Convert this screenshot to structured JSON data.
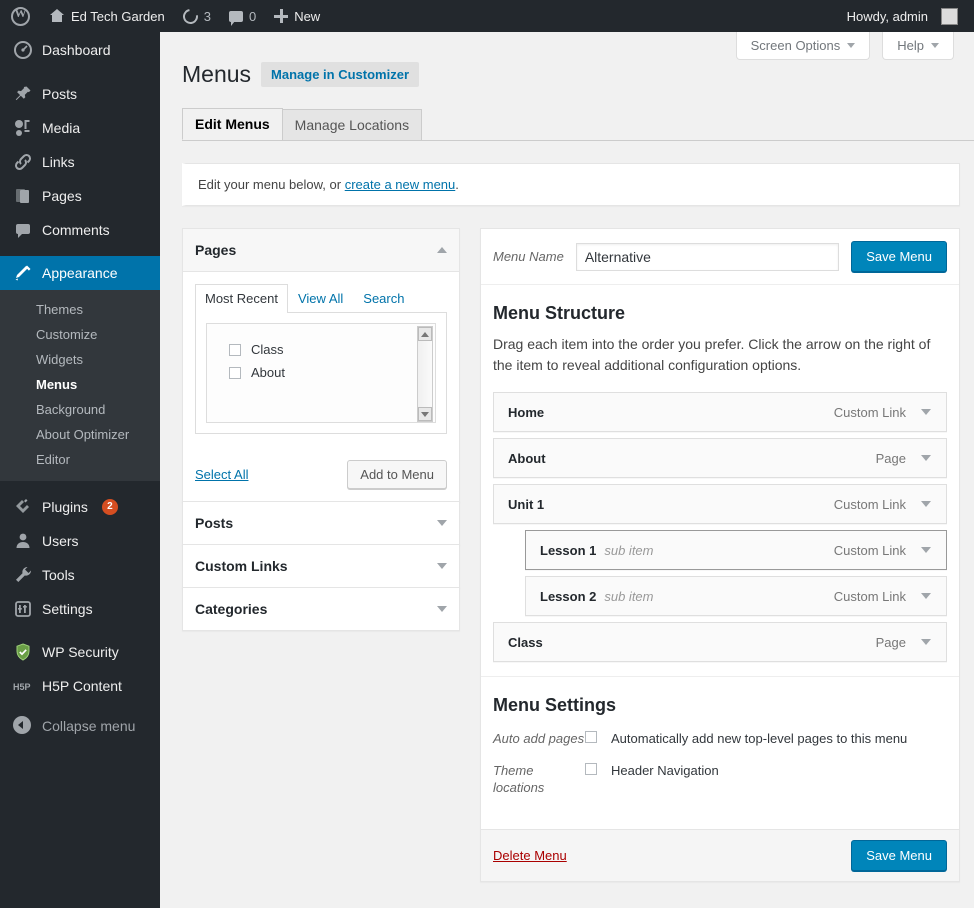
{
  "adminbar": {
    "site_name": "Ed Tech Garden",
    "updates_count": "3",
    "comments_count": "0",
    "new_label": "New",
    "howdy": "Howdy, admin"
  },
  "sidebar": {
    "items": [
      {
        "label": "Dashboard",
        "icon": "dashboard-icon"
      },
      {
        "label": "Posts",
        "icon": "pin-icon"
      },
      {
        "label": "Media",
        "icon": "media-icon"
      },
      {
        "label": "Links",
        "icon": "link-icon"
      },
      {
        "label": "Pages",
        "icon": "pages-icon"
      },
      {
        "label": "Comments",
        "icon": "comment-icon"
      },
      {
        "label": "Appearance",
        "icon": "brush-icon"
      },
      {
        "label": "Plugins",
        "icon": "plug-icon",
        "badge": "2"
      },
      {
        "label": "Users",
        "icon": "user-icon"
      },
      {
        "label": "Tools",
        "icon": "wrench-icon"
      },
      {
        "label": "Settings",
        "icon": "settings-icon"
      },
      {
        "label": "WP Security",
        "icon": "shield-icon"
      },
      {
        "label": "H5P Content",
        "icon": "h5p-icon"
      },
      {
        "label": "Collapse menu",
        "icon": "collapse-icon"
      }
    ],
    "appearance_submenu": [
      "Themes",
      "Customize",
      "Widgets",
      "Menus",
      "Background",
      "About Optimizer",
      "Editor"
    ],
    "current_submenu": "Menus"
  },
  "screen_meta": {
    "screen_options": "Screen Options",
    "help": "Help"
  },
  "header": {
    "title": "Menus",
    "customizer_button": "Manage in Customizer"
  },
  "tabs": [
    {
      "label": "Edit Menus",
      "active": true
    },
    {
      "label": "Manage Locations",
      "active": false
    }
  ],
  "notice": {
    "prefix": "Edit your menu below, or ",
    "link": "create a new menu",
    "suffix": "."
  },
  "accordions": [
    {
      "title": "Pages",
      "open": true
    },
    {
      "title": "Posts",
      "open": false
    },
    {
      "title": "Custom Links",
      "open": false
    },
    {
      "title": "Categories",
      "open": false
    }
  ],
  "pages_panel": {
    "tabs": [
      {
        "label": "Most Recent",
        "active": true
      },
      {
        "label": "View All",
        "active": false
      },
      {
        "label": "Search",
        "active": false
      }
    ],
    "items": [
      {
        "label": "Class",
        "checked": false
      },
      {
        "label": "About",
        "checked": false
      }
    ],
    "select_all": "Select All",
    "add_to_menu": "Add to Menu"
  },
  "menu_editor": {
    "menu_name_label": "Menu Name",
    "menu_name_value": "Alternative",
    "menu_name_placeholder": "Menu Name",
    "save_label": "Save Menu",
    "structure_title": "Menu Structure",
    "structure_desc": "Drag each item into the order you prefer. Click the arrow on the right of the item to reveal additional configuration options.",
    "items": [
      {
        "title": "Home",
        "sub": "",
        "type": "Custom Link",
        "depth": 0,
        "focused": false
      },
      {
        "title": "About",
        "sub": "",
        "type": "Page",
        "depth": 0,
        "focused": false
      },
      {
        "title": "Unit 1",
        "sub": "",
        "type": "Custom Link",
        "depth": 0,
        "focused": false
      },
      {
        "title": "Lesson 1",
        "sub": "sub item",
        "type": "Custom Link",
        "depth": 1,
        "focused": true
      },
      {
        "title": "Lesson 2",
        "sub": "sub item",
        "type": "Custom Link",
        "depth": 1,
        "focused": false
      },
      {
        "title": "Class",
        "sub": "",
        "type": "Page",
        "depth": 0,
        "focused": false
      }
    ]
  },
  "menu_settings": {
    "title": "Menu Settings",
    "auto_add_label": "Auto add pages",
    "auto_add_text": "Automatically add new top-level pages to this menu",
    "auto_add_checked": false,
    "theme_locations_label": "Theme locations",
    "theme_location_text": "Header Navigation",
    "theme_location_checked": false
  },
  "footer": {
    "delete_label": "Delete Menu",
    "save_label": "Save Menu"
  },
  "colors": {
    "admin_bar": "#23282d",
    "sidebar": "#23282d",
    "submenu": "#32373c",
    "accent_blue": "#0073aa",
    "button_blue": "#0085ba",
    "badge_orange": "#d54e21",
    "delete_red": "#a00"
  }
}
